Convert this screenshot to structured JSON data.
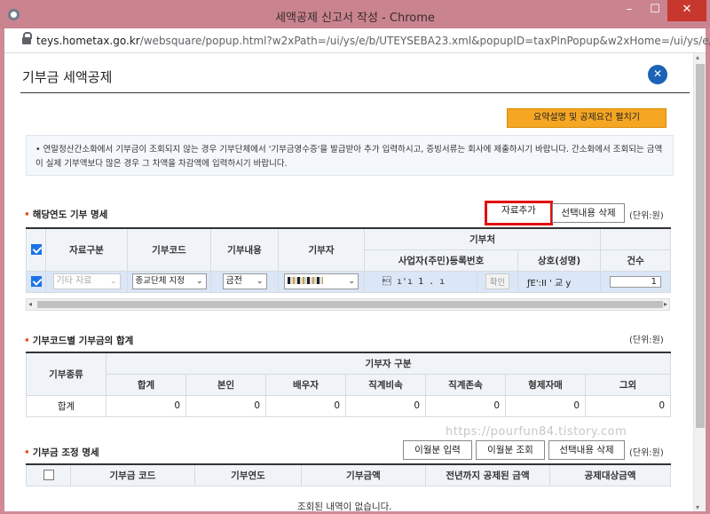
{
  "window": {
    "title": "세액공제 신고서 작성 - Chrome",
    "min": "–",
    "max": "☐",
    "close": "✕",
    "url_host": "teys.hometax.go.kr",
    "url_path": "/websquare/popup.html?w2xPath=/ui/ys/e/b/UTEYSEBA23.xml&popupID=taxPlnPopup&w2xHome=/ui/ys/e/b/&..."
  },
  "page": {
    "title": "기부금 세액공제",
    "close": "✕"
  },
  "summary_button": "요약설명 및 공제요건 펼치기",
  "notice": "• 연말정산간소화에서 기부금이 조회되지 않는 경우 기부단체에서 '기부금영수증'을 발급받아 추가 입력하시고, 증빙서류는 회사에 제출하시기 바랍니다. 간소화에서 조회되는 금액이 실제 기부액보다 많은 경우 그 차액을 차감액에 입력하시기 바랍니다.",
  "section1": {
    "title": "해당연도 기부 명세",
    "add_button": "자료추가",
    "delete_button": "선택내용 삭제",
    "unit": "(단위:원)",
    "headers": {
      "type": "자료구분",
      "code": "기부코드",
      "content": "기부내용",
      "donor": "기부자",
      "org": "기부처",
      "biz_no": "사업자(주민)등록번호",
      "name": "상호(성명)",
      "count": "건수"
    },
    "row": {
      "type": "기타 자료",
      "code": "종교단체 지정",
      "content": "금전",
      "biz_no": "\u0012 ı'ı 1 . ı",
      "verify": "확인",
      "name": "ƒE':II ' 교 y",
      "count": "1"
    }
  },
  "section2": {
    "title": "기부코드별 기부금의 합계",
    "unit": "(단위:원)",
    "kind_header": "기부종류",
    "group_header": "기부자 구분",
    "columns": [
      "합계",
      "본인",
      "배우자",
      "직계비속",
      "직계존속",
      "형제자매",
      "그외"
    ],
    "row_label": "합계",
    "values": [
      "0",
      "0",
      "0",
      "0",
      "0",
      "0",
      "0"
    ]
  },
  "section3": {
    "title": "기부금 조정 명세",
    "btn_prev": "이월분 입력",
    "btn_query": "이월분 조회",
    "btn_delete": "선택내용 삭제",
    "unit": "(단위:원)",
    "columns": [
      "기부금 코드",
      "기부연도",
      "기부금액",
      "전년까지 공제된 금액",
      "공제대상금액"
    ],
    "empty": "조회된 내역이 없습니다."
  },
  "watermark": "https://pourfun84.tistory.com"
}
